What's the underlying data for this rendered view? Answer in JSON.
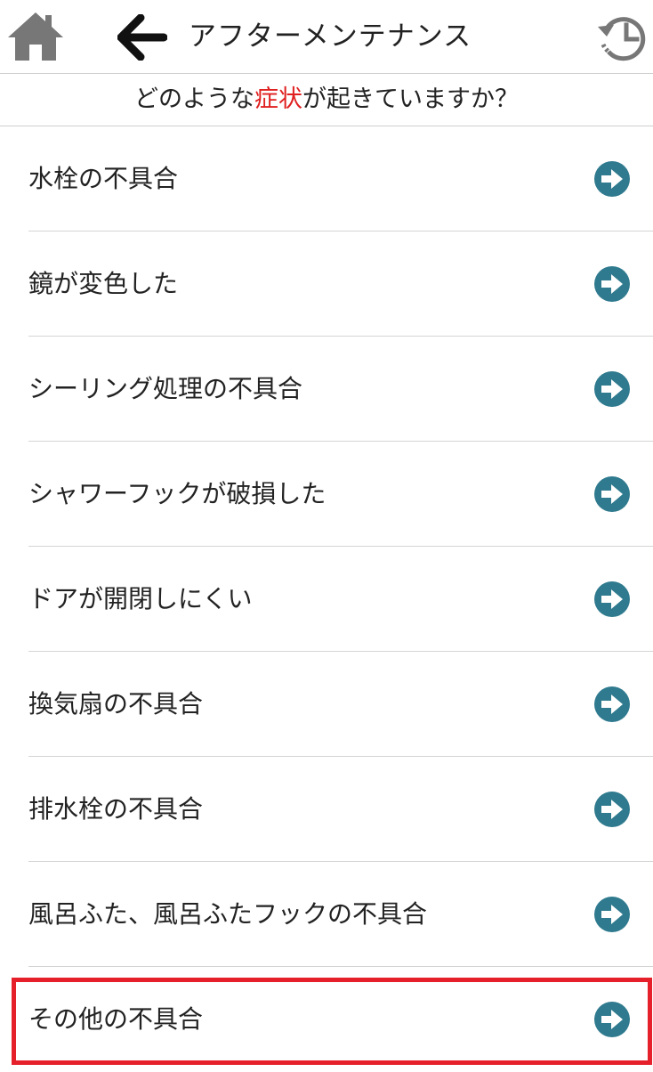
{
  "header": {
    "title": "アフターメンテナンス",
    "home_icon": "home-icon",
    "back_icon": "arrow-left-icon",
    "history_icon": "history-clock-icon",
    "icon_color": "#777777"
  },
  "prompt": {
    "before": "どのような",
    "highlight": "症状",
    "after": "が起きていますか？",
    "highlight_color": "#e02020"
  },
  "items": [
    {
      "label": "水栓の不具合"
    },
    {
      "label": "鏡が変色した"
    },
    {
      "label": "シーリング処理の不具合"
    },
    {
      "label": "シャワーフックが破損した"
    },
    {
      "label": "ドアが開閉しにくい"
    },
    {
      "label": "換気扇の不具合"
    },
    {
      "label": "排水栓の不具合"
    },
    {
      "label": "風呂ふた、風呂ふたフックの不具合"
    },
    {
      "label": "その他の不具合"
    }
  ],
  "item_icon": "arrow-right-circle-icon",
  "arrow_color": "#2f7a8e",
  "highlighted_item": "その他の不具合",
  "highlight_frame_color": "#e5202b"
}
